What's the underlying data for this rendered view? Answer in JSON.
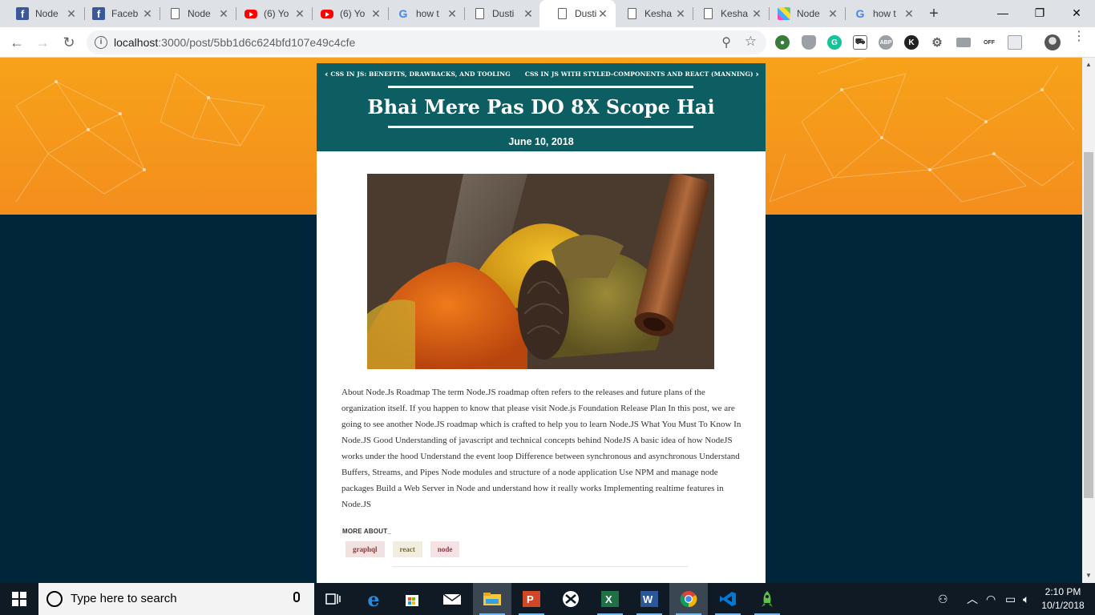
{
  "browser": {
    "tabs": [
      {
        "title": "Node",
        "icon": "facebook-icon"
      },
      {
        "title": "Faceb",
        "icon": "facebook-icon"
      },
      {
        "title": "Node",
        "icon": "document-icon"
      },
      {
        "title": "(6) Yo",
        "icon": "youtube-icon"
      },
      {
        "title": "(6) Yo",
        "icon": "youtube-icon"
      },
      {
        "title": "how t",
        "icon": "google-icon"
      },
      {
        "title": "Dusti",
        "icon": "document-icon"
      },
      {
        "title": "Dusti",
        "icon": "document-icon",
        "active": true
      },
      {
        "title": "Kesha",
        "icon": "document-icon"
      },
      {
        "title": "Kesha",
        "icon": "document-icon"
      },
      {
        "title": "Node",
        "icon": "mosaic-icon"
      },
      {
        "title": "how t",
        "icon": "google-icon"
      }
    ],
    "url_host": "localhost",
    "url_rest": ":3000/post/5bb1d6c624bfd107e49c4cfe",
    "extensions": [
      "globe-extension-icon",
      "shield-extension-icon",
      "grammarly-extension-icon",
      "car-extension-icon",
      "adblock-extension-icon",
      "k-extension-icon",
      "gear-extension-icon",
      "card-extension-icon",
      "off-extension-icon",
      "page-extension-icon"
    ],
    "ext_labels": {
      "grammarly": "G",
      "adblock": "ABP",
      "k": "K",
      "off": "OFF"
    }
  },
  "post": {
    "prev_link": "CSS IN JS: BENEFITS, DRAWBACKS, AND TOOLING",
    "next_link": "CSS IN JS WITH STYLED-COMPONENTS AND REACT (MANNING)",
    "title": "Bhai Mere Pas DO 8X Scope Hai",
    "date": "June 10, 2018",
    "image_alt": "spices",
    "body": "About Node.Js Roadmap The term Node.JS roadmap often refers to the releases and future plans of the organization itself. If you happen to know that please visit Node.js Foundation Release Plan In this post, we are going to see another Node.JS roadmap which is crafted to help you to learn Node.JS What You Must To Know In Node.JS Good Understanding of javascript and technical concepts behind NodeJS A basic idea of how NodeJS works under the hood Understand the event loop Difference between synchronous and asynchronous Understand Buffers, Streams, and Pipes Node modules and structure of a node application Use NPM and manage node packages Build a Web Server in Node and understand how it really works Implementing realtime features in Node.JS",
    "more_about": "MORE ABOUT_",
    "tags": [
      {
        "label": "graphql",
        "bg": "#f2e1e1",
        "color": "#8a3a3a"
      },
      {
        "label": "react",
        "bg": "#f1eedf",
        "color": "#7a6a3a"
      },
      {
        "label": "node",
        "bg": "#f4e2e4",
        "color": "#8a3a45"
      }
    ]
  },
  "colors": {
    "hero_orange": "#f7a21a",
    "page_navy": "#01263a",
    "card_teal": "#0c5e63"
  },
  "taskbar": {
    "search_placeholder": "Type here to search",
    "apps": [
      "task-view-icon",
      "edge-icon",
      "store-icon",
      "mail-icon",
      "file-explorer-icon",
      "powerpoint-icon",
      "xbox-icon",
      "excel-icon",
      "word-icon",
      "chrome-icon",
      "vscode-icon",
      "rocket-app-icon"
    ],
    "time": "2:10 PM",
    "date": "10/1/2018"
  }
}
